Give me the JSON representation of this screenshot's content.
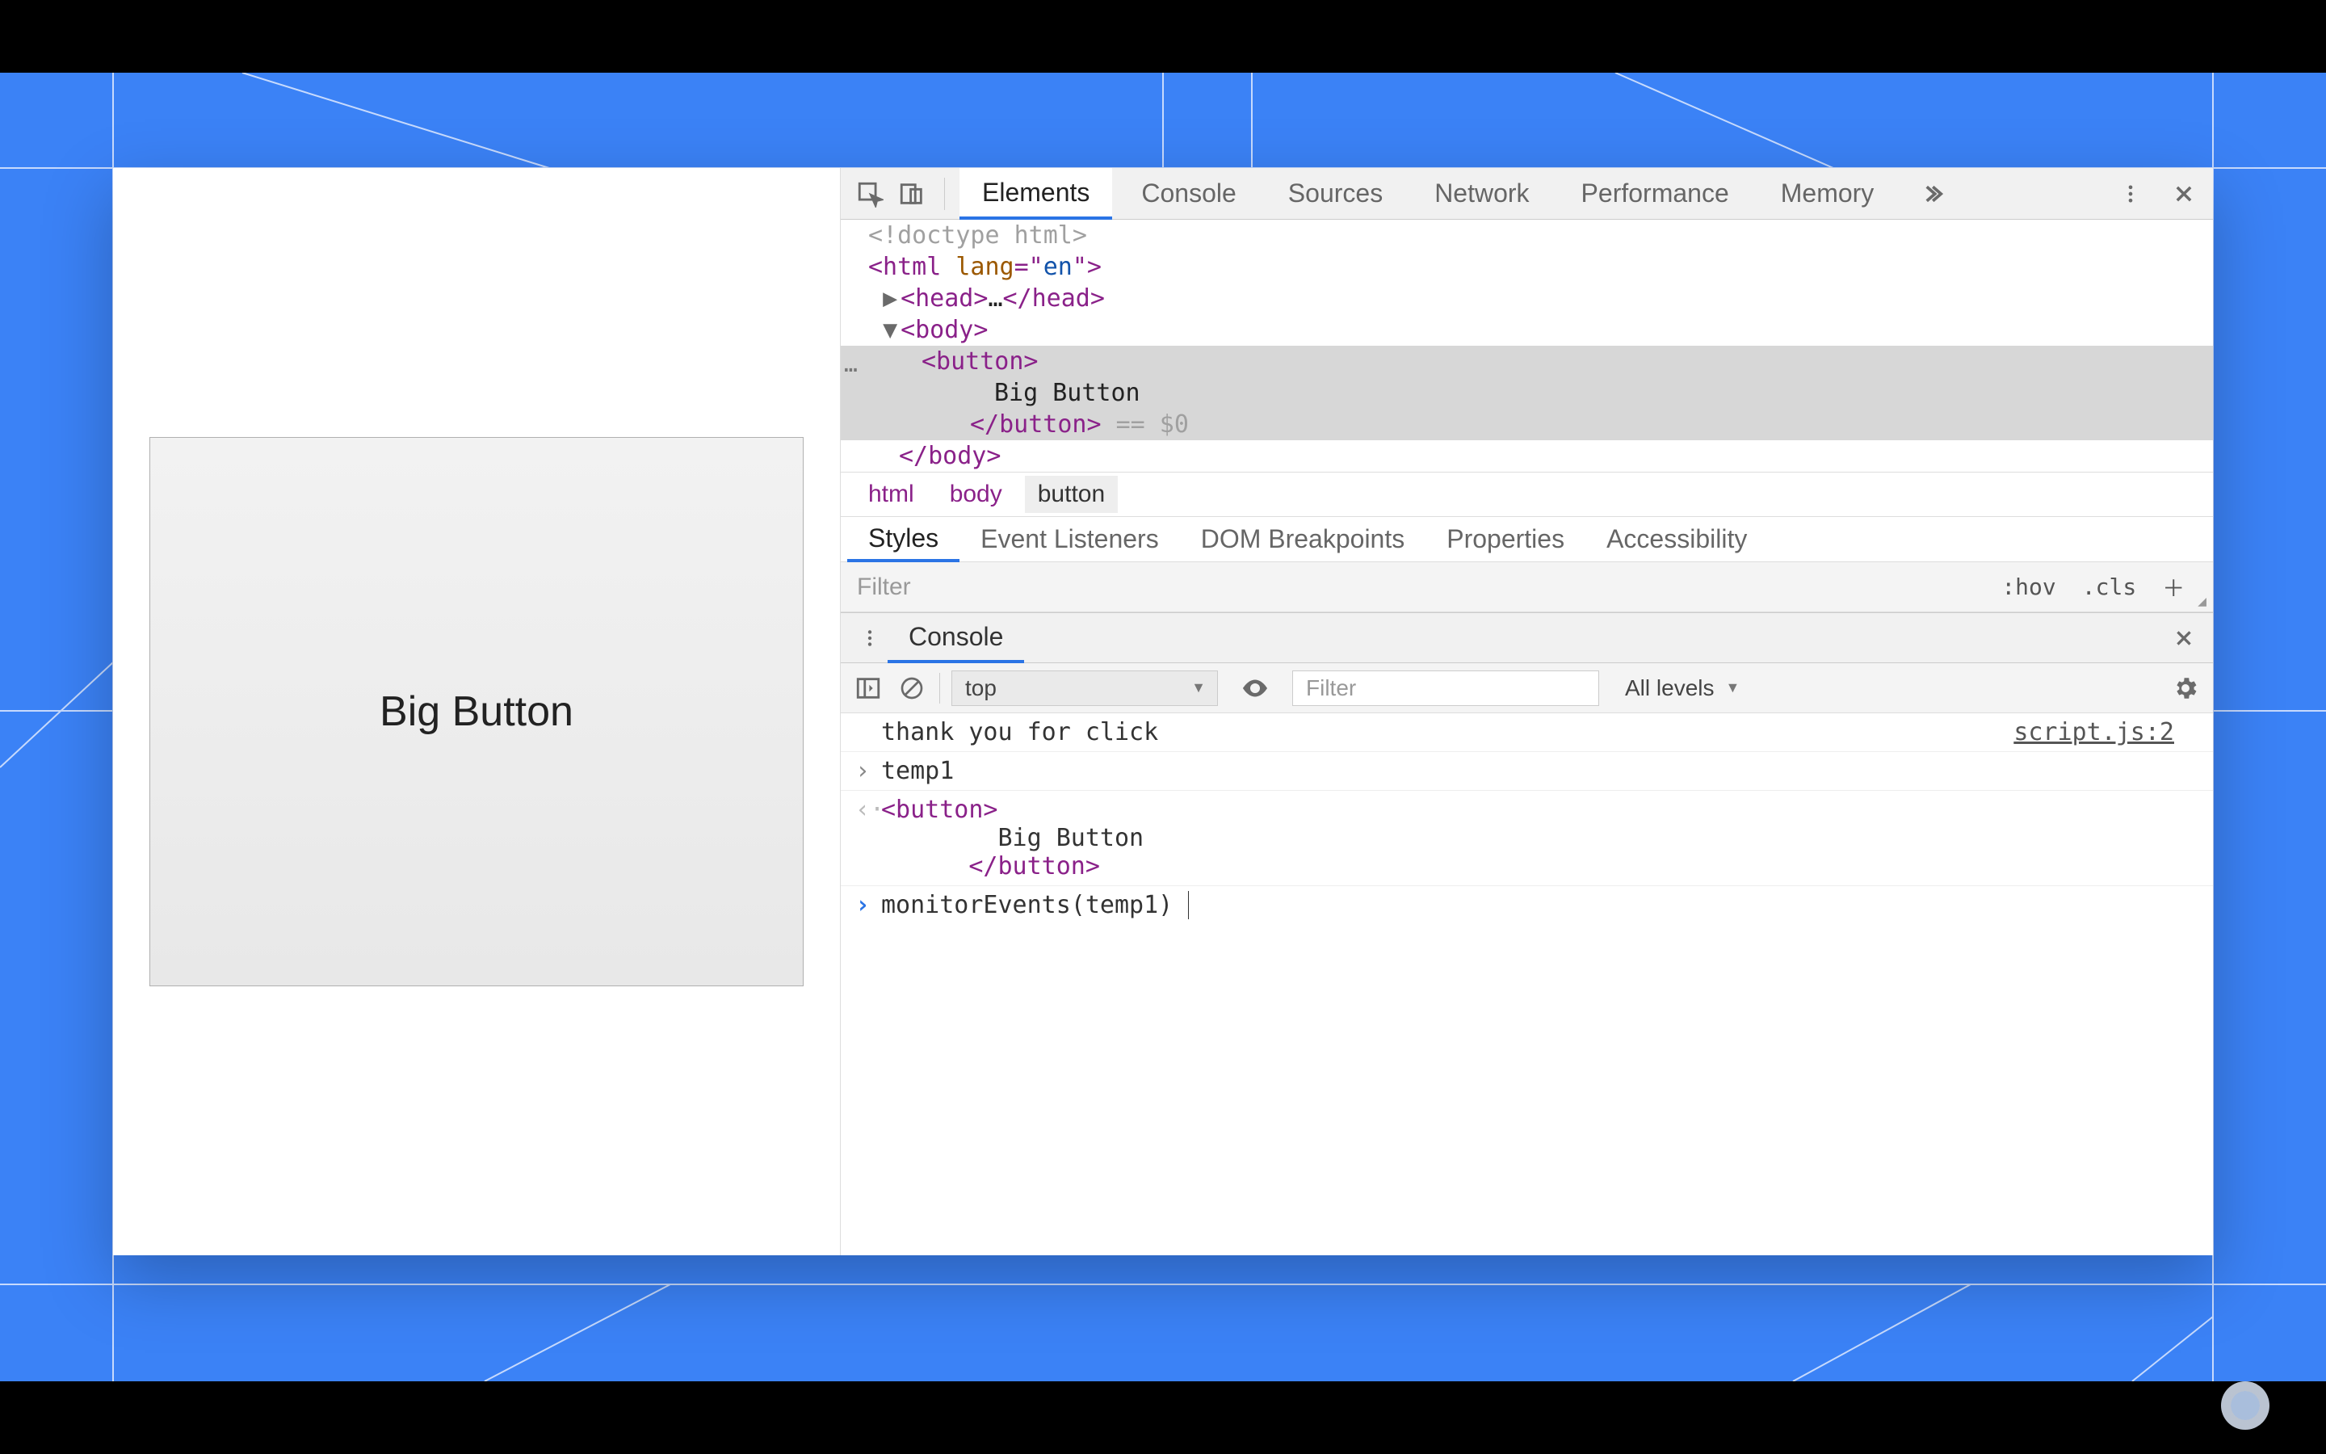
{
  "page": {
    "button_label": "Big Button"
  },
  "devtools": {
    "tabs": [
      "Elements",
      "Console",
      "Sources",
      "Network",
      "Performance",
      "Memory"
    ],
    "active_tab": "Elements",
    "dom": {
      "doctype": "<!doctype html>",
      "html_open": "<html lang=\"en\">",
      "head_collapsed": "<head>…</head>",
      "body_open": "<body>",
      "button_open": "<button>",
      "button_text": "Big Button",
      "button_close": "</button>",
      "selected_suffix": " == $0",
      "body_close_partial": "</body>"
    },
    "breadcrumb": [
      "html",
      "body",
      "button"
    ],
    "breadcrumb_active": "button",
    "subtabs": [
      "Styles",
      "Event Listeners",
      "DOM Breakpoints",
      "Properties",
      "Accessibility"
    ],
    "subtabs_active": "Styles",
    "styles_filter_placeholder": "Filter",
    "styles_tools": {
      "hov": ":hov",
      "cls": ".cls"
    }
  },
  "console": {
    "title": "Console",
    "context": "top",
    "filter_placeholder": "Filter",
    "levels_label": "All levels",
    "log_message": "thank you for click",
    "log_source": "script.js:2",
    "entries": {
      "temp1_prompt": "temp1",
      "result_button_open": "<button>",
      "result_button_text": "Big Button",
      "result_button_close": "</button>",
      "current_input": "monitorEvents(temp1)"
    }
  }
}
